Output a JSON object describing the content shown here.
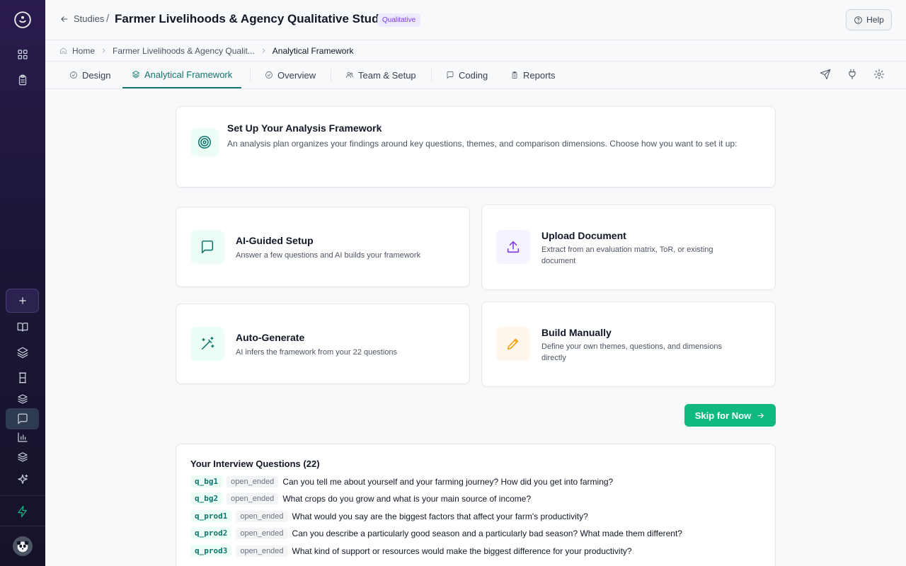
{
  "header": {
    "back_label": "Studies",
    "separator": "/",
    "title": "Farmer Livelihoods & Agency Qualitative Study",
    "badge": "Qualitative",
    "help_label": "Help"
  },
  "breadcrumb": {
    "home": "Home",
    "study": "Farmer Livelihoods & Agency Qualit...",
    "current": "Analytical Framework"
  },
  "tabs": [
    {
      "label": "Design",
      "icon": "check-circle-icon"
    },
    {
      "label": "Analytical Framework",
      "icon": "layers-icon",
      "active": true
    },
    {
      "label": "Overview",
      "icon": "check-circle-icon"
    },
    {
      "label": "Team & Setup",
      "icon": "users-icon"
    },
    {
      "label": "Coding",
      "icon": "message-square-icon"
    },
    {
      "label": "Reports",
      "icon": "clipboard-icon"
    }
  ],
  "intro": {
    "title": "Set Up Your Analysis Framework",
    "description": "An analysis plan organizes your findings around key questions, themes, and comparison dimensions. Choose how you want to set it up:"
  },
  "options": {
    "ai_guided": {
      "title": "AI-Guided Setup",
      "description": "Answer a few questions and AI builds your framework"
    },
    "upload": {
      "title": "Upload Document",
      "description": "Extract from an evaluation matrix, ToR, or existing document"
    },
    "auto": {
      "title": "Auto-Generate",
      "description": "AI infers the framework from your 22 questions"
    },
    "manual": {
      "title": "Build Manually",
      "description": "Define your own themes, questions, and dimensions directly"
    }
  },
  "skip_label": "Skip for Now",
  "questions": {
    "title": "Your Interview Questions (22)",
    "items": [
      {
        "id": "q_bg1",
        "type": "open_ended",
        "text": "Can you tell me about yourself and your farming journey? How did you get into farming?"
      },
      {
        "id": "q_bg2",
        "type": "open_ended",
        "text": "What crops do you grow and what is your main source of income?"
      },
      {
        "id": "q_prod1",
        "type": "open_ended",
        "text": "What would you say are the biggest factors that affect your farm's productivity?"
      },
      {
        "id": "q_prod2",
        "type": "open_ended",
        "text": "Can you describe a particularly good season and a particularly bad season? What made them different?"
      },
      {
        "id": "q_prod3",
        "type": "open_ended",
        "text": "What kind of support or resources would make the biggest difference for your productivity?"
      }
    ]
  },
  "colors": {
    "accent": "#0f766e",
    "primary_button": "#10b981",
    "badge_bg": "#ede9fe",
    "badge_text": "#7c3aed"
  }
}
